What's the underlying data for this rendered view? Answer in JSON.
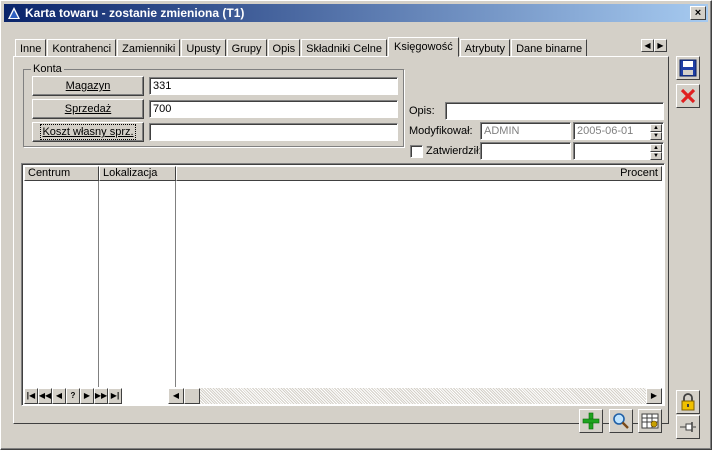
{
  "window": {
    "title": "Karta towaru - zostanie zmieniona (T1)",
    "close_label": "×"
  },
  "tabs": [
    {
      "label": "Inne"
    },
    {
      "label": "Kontrahenci"
    },
    {
      "label": "Zamienniki"
    },
    {
      "label": "Upusty"
    },
    {
      "label": "Grupy"
    },
    {
      "label": "Opis"
    },
    {
      "label": "Składniki Celne"
    },
    {
      "label": "Księgowość",
      "active": true
    },
    {
      "label": "Atrybuty"
    },
    {
      "label": "Dane binarne"
    }
  ],
  "tab_scroll": {
    "left": "◀",
    "right": "▶"
  },
  "konta": {
    "legend": "Konta",
    "magazyn_label": "Magazyn",
    "magazyn_value": "331",
    "sprzedaz_label": "Sprzedaż",
    "sprzedaz_value": "700",
    "koszt_label": "Koszt własny sprz.",
    "koszt_value": ""
  },
  "details": {
    "opis_label": "Opis:",
    "opis_value": "",
    "modyfikowal_label": "Modyfikował:",
    "modyfikowal_user": "ADMIN",
    "modyfikowal_date": "2005-06-01",
    "zatwierdzil_label": "Zatwierdził:",
    "zatwierdzil_user": "",
    "zatwierdzil_date": "",
    "zatwierdzil_checked": false
  },
  "grid": {
    "columns": [
      "Centrum",
      "Lokalizacja",
      "Procent"
    ],
    "rows": [],
    "nav": [
      "|◀",
      "◀◀",
      "◀",
      "?",
      "▶",
      "▶▶",
      "▶|"
    ],
    "scroll_left": "◀",
    "scroll_right": "▶"
  },
  "colors": {
    "title_start": "#0a246a",
    "title_end": "#a6caf0",
    "face": "#d4d0c8",
    "save_icon": "#1f3fa6",
    "cancel_icon": "#e02020",
    "add_icon": "#1fa31f"
  },
  "icons": {
    "save": "floppy-disk-icon",
    "cancel": "red-x-icon",
    "add": "green-plus-icon",
    "search": "magnifier-icon",
    "grid_options": "grid-options-icon",
    "lock": "padlock-icon",
    "pin": "pushpin-icon"
  }
}
